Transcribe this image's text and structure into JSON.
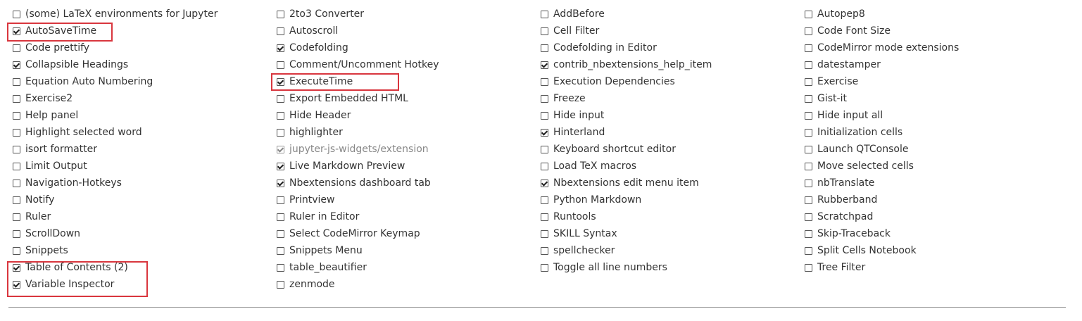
{
  "extensions": [
    [
      {
        "label": "(some) LaTeX environments for Jupyter",
        "checked": false,
        "disabled": false
      },
      {
        "label": "AutoSaveTime",
        "checked": true,
        "disabled": false
      },
      {
        "label": "Code prettify",
        "checked": false,
        "disabled": false
      },
      {
        "label": "Collapsible Headings",
        "checked": true,
        "disabled": false
      },
      {
        "label": "Equation Auto Numbering",
        "checked": false,
        "disabled": false
      },
      {
        "label": "Exercise2",
        "checked": false,
        "disabled": false
      },
      {
        "label": "Help panel",
        "checked": false,
        "disabled": false
      },
      {
        "label": "Highlight selected word",
        "checked": false,
        "disabled": false
      },
      {
        "label": "isort formatter",
        "checked": false,
        "disabled": false
      },
      {
        "label": "Limit Output",
        "checked": false,
        "disabled": false
      },
      {
        "label": "Navigation-Hotkeys",
        "checked": false,
        "disabled": false
      },
      {
        "label": "Notify",
        "checked": false,
        "disabled": false
      },
      {
        "label": "Ruler",
        "checked": false,
        "disabled": false
      },
      {
        "label": "ScrollDown",
        "checked": false,
        "disabled": false
      },
      {
        "label": "Snippets",
        "checked": false,
        "disabled": false
      },
      {
        "label": "Table of Contents (2)",
        "checked": true,
        "disabled": false
      },
      {
        "label": "Variable Inspector",
        "checked": true,
        "disabled": false
      }
    ],
    [
      {
        "label": "2to3 Converter",
        "checked": false,
        "disabled": false
      },
      {
        "label": "Autoscroll",
        "checked": false,
        "disabled": false
      },
      {
        "label": "Codefolding",
        "checked": true,
        "disabled": false
      },
      {
        "label": "Comment/Uncomment Hotkey",
        "checked": false,
        "disabled": false
      },
      {
        "label": "ExecuteTime",
        "checked": true,
        "disabled": false
      },
      {
        "label": "Export Embedded HTML",
        "checked": false,
        "disabled": false
      },
      {
        "label": "Hide Header",
        "checked": false,
        "disabled": false
      },
      {
        "label": "highlighter",
        "checked": false,
        "disabled": false
      },
      {
        "label": "jupyter-js-widgets/extension",
        "checked": true,
        "disabled": true
      },
      {
        "label": "Live Markdown Preview",
        "checked": true,
        "disabled": false
      },
      {
        "label": "Nbextensions dashboard tab",
        "checked": true,
        "disabled": false
      },
      {
        "label": "Printview",
        "checked": false,
        "disabled": false
      },
      {
        "label": "Ruler in Editor",
        "checked": false,
        "disabled": false
      },
      {
        "label": "Select CodeMirror Keymap",
        "checked": false,
        "disabled": false
      },
      {
        "label": "Snippets Menu",
        "checked": false,
        "disabled": false
      },
      {
        "label": "table_beautifier",
        "checked": false,
        "disabled": false
      },
      {
        "label": "zenmode",
        "checked": false,
        "disabled": false
      }
    ],
    [
      {
        "label": "AddBefore",
        "checked": false,
        "disabled": false
      },
      {
        "label": "Cell Filter",
        "checked": false,
        "disabled": false
      },
      {
        "label": "Codefolding in Editor",
        "checked": false,
        "disabled": false
      },
      {
        "label": "contrib_nbextensions_help_item",
        "checked": true,
        "disabled": false
      },
      {
        "label": "Execution Dependencies",
        "checked": false,
        "disabled": false
      },
      {
        "label": "Freeze",
        "checked": false,
        "disabled": false
      },
      {
        "label": "Hide input",
        "checked": false,
        "disabled": false
      },
      {
        "label": "Hinterland",
        "checked": true,
        "disabled": false
      },
      {
        "label": "Keyboard shortcut editor",
        "checked": false,
        "disabled": false
      },
      {
        "label": "Load TeX macros",
        "checked": false,
        "disabled": false
      },
      {
        "label": "Nbextensions edit menu item",
        "checked": true,
        "disabled": false
      },
      {
        "label": "Python Markdown",
        "checked": false,
        "disabled": false
      },
      {
        "label": "Runtools",
        "checked": false,
        "disabled": false
      },
      {
        "label": "SKILL Syntax",
        "checked": false,
        "disabled": false
      },
      {
        "label": "spellchecker",
        "checked": false,
        "disabled": false
      },
      {
        "label": "Toggle all line numbers",
        "checked": false,
        "disabled": false
      }
    ],
    [
      {
        "label": "Autopep8",
        "checked": false,
        "disabled": false
      },
      {
        "label": "Code Font Size",
        "checked": false,
        "disabled": false
      },
      {
        "label": "CodeMirror mode extensions",
        "checked": false,
        "disabled": false
      },
      {
        "label": "datestamper",
        "checked": false,
        "disabled": false
      },
      {
        "label": "Exercise",
        "checked": false,
        "disabled": false
      },
      {
        "label": "Gist-it",
        "checked": false,
        "disabled": false
      },
      {
        "label": "Hide input all",
        "checked": false,
        "disabled": false
      },
      {
        "label": "Initialization cells",
        "checked": false,
        "disabled": false
      },
      {
        "label": "Launch QTConsole",
        "checked": false,
        "disabled": false
      },
      {
        "label": "Move selected cells",
        "checked": false,
        "disabled": false
      },
      {
        "label": "nbTranslate",
        "checked": false,
        "disabled": false
      },
      {
        "label": "Rubberband",
        "checked": false,
        "disabled": false
      },
      {
        "label": "Scratchpad",
        "checked": false,
        "disabled": false
      },
      {
        "label": "Skip-Traceback",
        "checked": false,
        "disabled": false
      },
      {
        "label": "Split Cells Notebook",
        "checked": false,
        "disabled": false
      },
      {
        "label": "Tree Filter",
        "checked": false,
        "disabled": false
      }
    ]
  ],
  "colors": {
    "highlight": "#d9363e",
    "text": "#333333",
    "disabled_text": "#888888",
    "divider": "#999999"
  }
}
